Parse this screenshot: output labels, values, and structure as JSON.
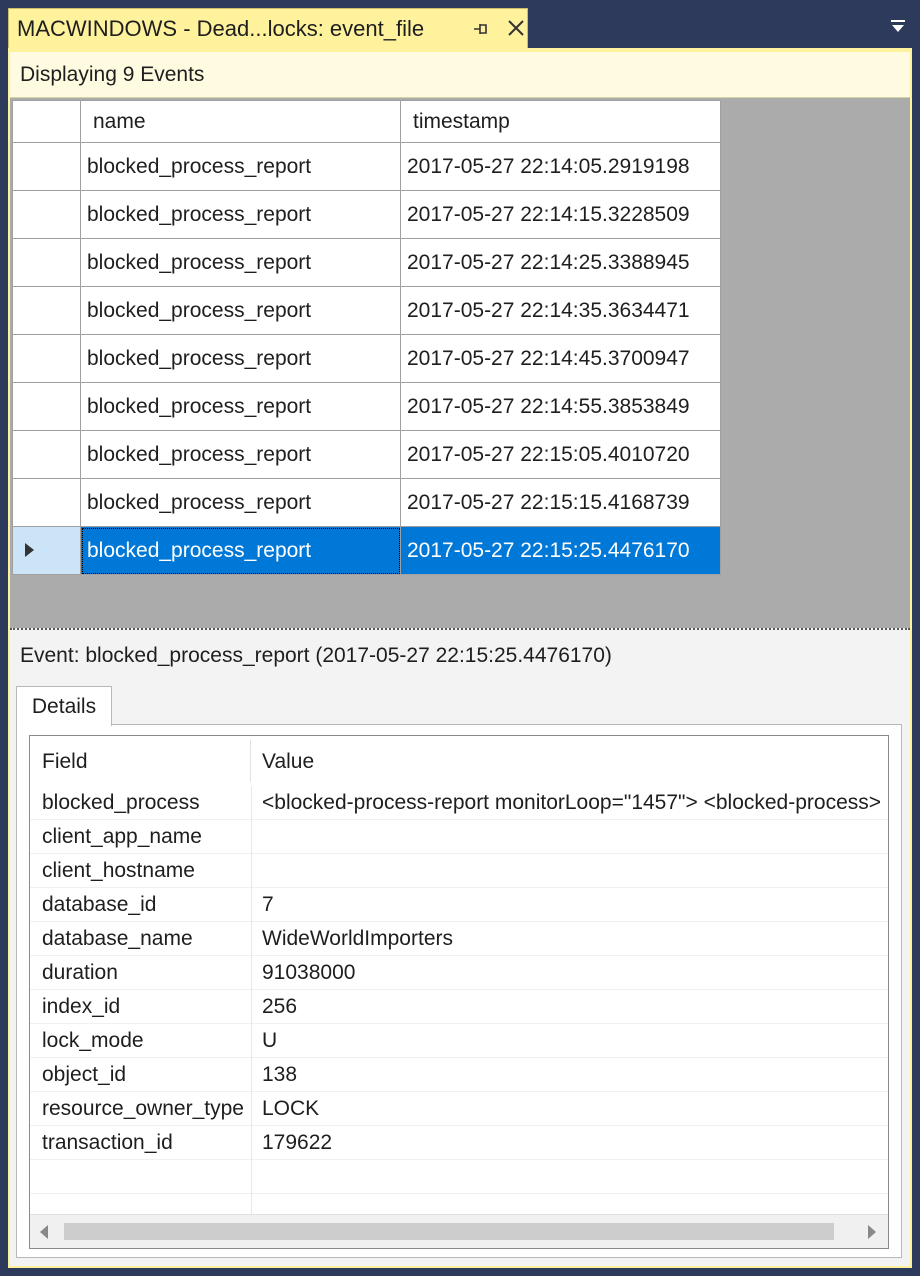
{
  "tab": {
    "title": "MACWINDOWS - Dead...locks: event_file"
  },
  "status": {
    "text": "Displaying 9 Events"
  },
  "grid": {
    "columns": [
      "name",
      "timestamp"
    ],
    "rows": [
      {
        "name": "blocked_process_report",
        "timestamp": "2017-05-27 22:14:05.2919198"
      },
      {
        "name": "blocked_process_report",
        "timestamp": "2017-05-27 22:14:15.3228509"
      },
      {
        "name": "blocked_process_report",
        "timestamp": "2017-05-27 22:14:25.3388945"
      },
      {
        "name": "blocked_process_report",
        "timestamp": "2017-05-27 22:14:35.3634471"
      },
      {
        "name": "blocked_process_report",
        "timestamp": "2017-05-27 22:14:45.3700947"
      },
      {
        "name": "blocked_process_report",
        "timestamp": "2017-05-27 22:14:55.3853849"
      },
      {
        "name": "blocked_process_report",
        "timestamp": "2017-05-27 22:15:05.4010720"
      },
      {
        "name": "blocked_process_report",
        "timestamp": "2017-05-27 22:15:15.4168739"
      },
      {
        "name": "blocked_process_report",
        "timestamp": "2017-05-27 22:15:25.4476170"
      }
    ],
    "selected_index": 8
  },
  "event_header": "Event: blocked_process_report (2017-05-27 22:15:25.4476170)",
  "details": {
    "tab_label": "Details",
    "field_header": "Field",
    "value_header": "Value",
    "fields": [
      {
        "field": "blocked_process",
        "value": "<blocked-process-report monitorLoop=\"1457\">   <blocked-process>"
      },
      {
        "field": "client_app_name",
        "value": ""
      },
      {
        "field": "client_hostname",
        "value": ""
      },
      {
        "field": "database_id",
        "value": "7"
      },
      {
        "field": "database_name",
        "value": "WideWorldImporters"
      },
      {
        "field": "duration",
        "value": "91038000"
      },
      {
        "field": "index_id",
        "value": "256"
      },
      {
        "field": "lock_mode",
        "value": "U"
      },
      {
        "field": "object_id",
        "value": "138"
      },
      {
        "field": "resource_owner_type",
        "value": "LOCK"
      },
      {
        "field": "transaction_id",
        "value": "179622"
      }
    ]
  },
  "colors": {
    "accent_tab": "#fff29d",
    "selection": "#0078d7",
    "chrome": "#2d3a5c"
  },
  "icons": {
    "pin": "pin-icon",
    "close": "close-icon",
    "dropdown": "dropdown-icon"
  }
}
